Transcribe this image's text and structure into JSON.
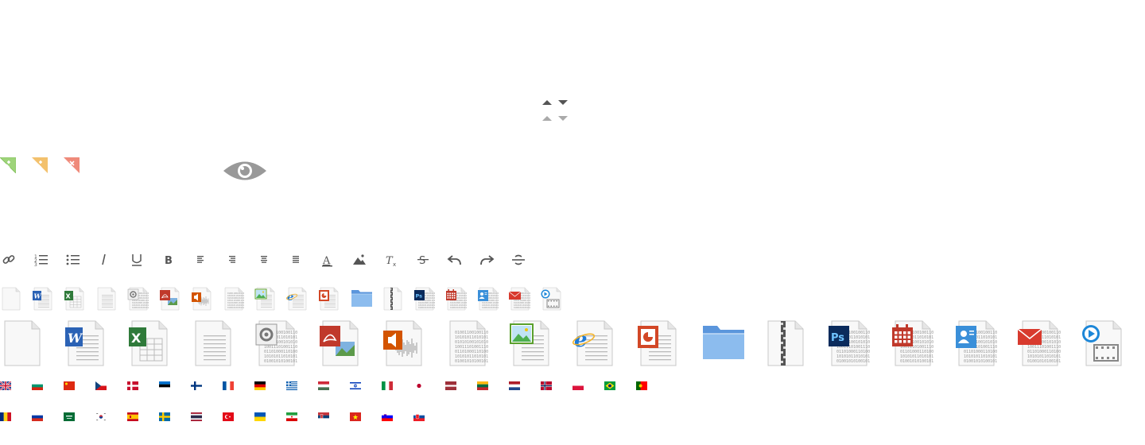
{
  "colors": {
    "green": "#9ed47a",
    "orange": "#f3c16d",
    "red": "#ef8a7a",
    "icon_gray": "#555555",
    "eye_gray": "#999999"
  },
  "sort_icons": [
    "sort-up-icon",
    "sort-down-icon",
    "sort-up-disabled-icon",
    "sort-down-disabled-icon"
  ],
  "corner_badges": [
    "corner-add-green-icon",
    "corner-add-orange-icon",
    "corner-remove-red-icon"
  ],
  "toolbar": [
    {
      "name": "link-icon"
    },
    {
      "name": "numbered-list-icon"
    },
    {
      "name": "bulleted-list-icon"
    },
    {
      "name": "italic-icon"
    },
    {
      "name": "underline-icon"
    },
    {
      "name": "bold-icon"
    },
    {
      "name": "align-left-icon"
    },
    {
      "name": "align-right-icon"
    },
    {
      "name": "align-center-icon"
    },
    {
      "name": "align-justify-icon"
    },
    {
      "name": "font-color-icon"
    },
    {
      "name": "background-color-icon"
    },
    {
      "name": "clear-format-icon"
    },
    {
      "name": "strikethrough-icon"
    },
    {
      "name": "undo-icon"
    },
    {
      "name": "redo-icon"
    },
    {
      "name": "horizontal-rule-icon"
    }
  ],
  "filetypes": [
    "blank",
    "word",
    "excel",
    "text",
    "settings",
    "pdf",
    "audio",
    "binary",
    "image",
    "html",
    "powerpoint",
    "folder",
    "zip",
    "photoshop",
    "calendar",
    "contact",
    "email",
    "video"
  ],
  "flags_row1": [
    "gb",
    "bg",
    "cn",
    "cz",
    "dk",
    "ee",
    "fi",
    "fr",
    "de",
    "gr",
    "hu",
    "il",
    "it",
    "jp",
    "lv",
    "lt",
    "nl",
    "no",
    "pl",
    "br",
    "pt"
  ],
  "flags_row2": [
    "ro",
    "ru",
    "sa",
    "kr",
    "es",
    "se",
    "th",
    "tr",
    "ua",
    "ir",
    "rs",
    "vn",
    "si",
    "sk"
  ]
}
